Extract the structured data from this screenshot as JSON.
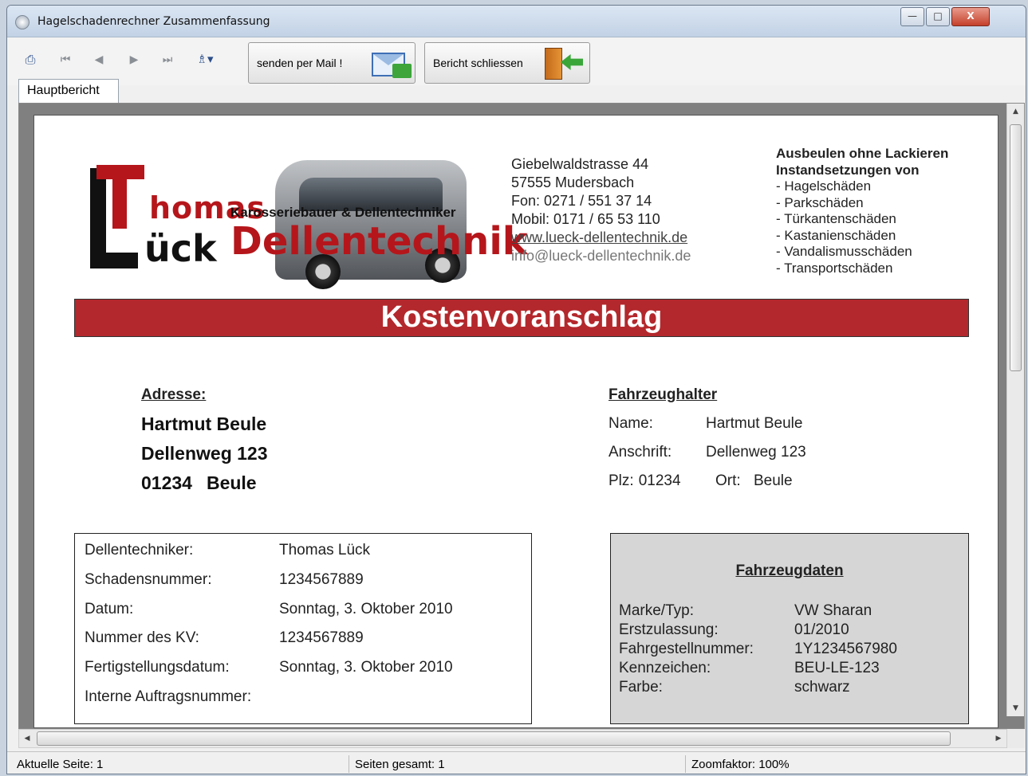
{
  "window": {
    "title": "Hagelschadenrechner Zusammenfassung",
    "controls": {
      "minimize": "—",
      "maximize": "□",
      "close": "X"
    }
  },
  "toolbar": {
    "print_icon": "printer-icon",
    "nav_first": "⏮",
    "nav_prev": "◀",
    "nav_next": "▶",
    "nav_last": "⏭",
    "find_icon": "♗▾",
    "mail_button": "senden per Mail !",
    "close_button": "Bericht schliessen"
  },
  "tabs": [
    "Hauptbericht"
  ],
  "report": {
    "logo": {
      "thomas": "homas",
      "lueck": "ück",
      "tagline": "Karosseriebauer & Dellentechniker",
      "dellentechnik": "Dellentechnik"
    },
    "contact": {
      "street": "Giebelwaldstrasse 44",
      "city": "57555 Mudersbach",
      "phone": "Fon: 0271 / 551 37 14",
      "mobile": "Mobil: 0171 / 65 53 110",
      "web": "www.lueck-dellentechnik.de",
      "email": "info@lueck-dellentechnik.de"
    },
    "services": {
      "title1": "Ausbeulen ohne Lackieren",
      "title2": "Instandsetzungen von",
      "items": [
        "- Hagelschäden",
        "- Parkschäden",
        "- Türkantenschäden",
        "- Kastanienschäden",
        "- Vandalismusschäden",
        "- Transportschäden"
      ]
    },
    "banner": "Kostenvoranschlag",
    "address": {
      "heading": "Adresse:",
      "name": "Hartmut Beule",
      "street": "Dellenweg 123",
      "zip": "01234",
      "city": "Beule"
    },
    "owner": {
      "heading": "Fahrzeughalter",
      "name_label": "Name:",
      "name_value": "Hartmut Beule",
      "address_label": "Anschrift:",
      "address_value": "Dellenweg 123",
      "plz_label": "Plz:",
      "plz_value": "01234",
      "ort_label": "Ort:",
      "ort_value": "Beule"
    },
    "details": [
      {
        "label": "Dellentechniker:",
        "value": "Thomas Lück"
      },
      {
        "label": "Schadensnummer:",
        "value": "1234567889"
      },
      {
        "label": "Datum:",
        "value": "Sonntag, 3. Oktober 2010"
      },
      {
        "label": "Nummer des KV:",
        "value": "1234567889"
      },
      {
        "label": "Fertigstellungsdatum:",
        "value": "Sonntag, 3. Oktober 2010"
      },
      {
        "label": "Interne Auftragsnummer:",
        "value": ""
      }
    ],
    "vehicle": {
      "heading": "Fahrzeugdaten",
      "rows": [
        {
          "label": "Marke/Typ:",
          "value": "VW Sharan"
        },
        {
          "label": "Erstzulassung:",
          "value": "01/2010"
        },
        {
          "label": "Fahrgestellnummer:",
          "value": "1Y1234567980"
        },
        {
          "label": "Kennzeichen:",
          "value": "BEU-LE-123"
        },
        {
          "label": "Farbe:",
          "value": "schwarz"
        }
      ]
    }
  },
  "scrollbars": {
    "up": "▲",
    "down": "▼",
    "left": "◀",
    "right": "▶",
    "h_grip": "III",
    "v_grip": "≡"
  },
  "status": {
    "current_page": "Aktuelle Seite: 1",
    "total_pages": "Seiten gesamt: 1",
    "zoom": "Zoomfaktor: 100%"
  },
  "colors": {
    "banner": "#b3282c",
    "brand_red": "#b5161b",
    "vehicle_box": "#d6d6d6"
  }
}
